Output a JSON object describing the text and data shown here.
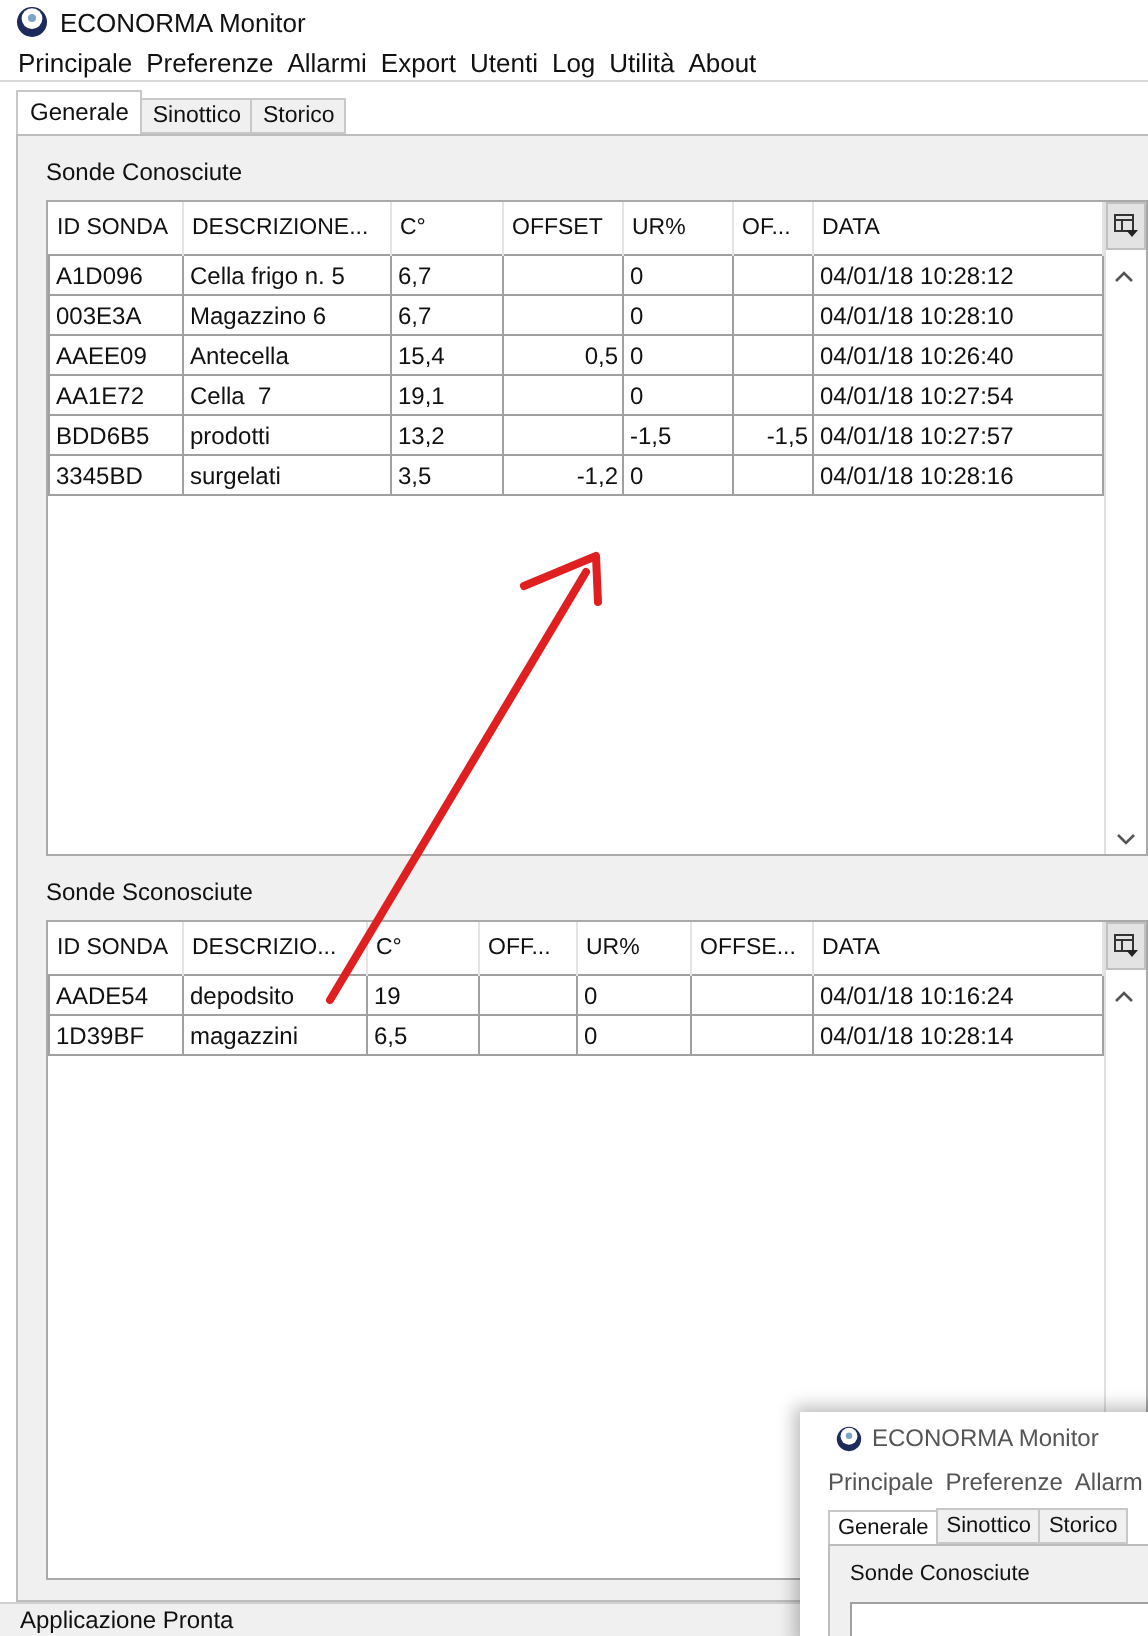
{
  "window": {
    "title": "ECONORMA Monitor"
  },
  "menu": [
    "Principale",
    "Preferenze",
    "Allarmi",
    "Export",
    "Utenti",
    "Log",
    "Utilità",
    "About"
  ],
  "tabs": [
    {
      "label": "Generale",
      "selected": true
    },
    {
      "label": "Sinottico",
      "selected": false
    },
    {
      "label": "Storico",
      "selected": false
    }
  ],
  "known_probes": {
    "title": "Sonde Conosciute",
    "columns": [
      "ID SONDA",
      "DESCRIZIONE...",
      "C°",
      "OFFSET",
      "UR%",
      "OF...",
      "DATA"
    ],
    "rows": [
      [
        "A1D096",
        "Cella frigo n. 5",
        "6,7",
        "",
        "0",
        "",
        "04/01/18 10:28:12"
      ],
      [
        "003E3A",
        "Magazzino 6",
        "6,7",
        "",
        "0",
        "",
        "04/01/18 10:28:10"
      ],
      [
        "AAEE09",
        "Antecella",
        "15,4",
        "0,5",
        "0",
        "",
        "04/01/18 10:26:40"
      ],
      [
        "AA1E72",
        "Cella  7",
        "19,1",
        "",
        "0",
        "",
        "04/01/18 10:27:54"
      ],
      [
        "BDD6B5",
        "prodotti",
        "13,2",
        "",
        "-1,5",
        "-1,5",
        "04/01/18 10:27:57"
      ],
      [
        "3345BD",
        "surgelati",
        "3,5",
        "-1,2",
        "0",
        "",
        "04/01/18 10:28:16"
      ]
    ]
  },
  "unknown_probes": {
    "title": "Sonde Sconosciute",
    "columns": [
      "ID SONDA",
      "DESCRIZIO...",
      "C°",
      "OFF...",
      "UR%",
      "OFFSE...",
      "DATA"
    ],
    "rows": [
      [
        "AADE54",
        "depodsito",
        "19",
        "",
        "0",
        "",
        "04/01/18 10:16:24"
      ],
      [
        "1D39BF",
        "magazzini",
        "6,5",
        "",
        "0",
        "",
        "04/01/18 10:28:14"
      ]
    ]
  },
  "status_bar": "Applicazione Pronta",
  "inset_window": {
    "title": "ECONORMA Monitor",
    "menu": [
      "Principale",
      "Preferenze",
      "Allarm"
    ],
    "tabs": [
      {
        "label": "Generale",
        "selected": true
      },
      {
        "label": "Sinottico",
        "selected": false
      },
      {
        "label": "Storico",
        "selected": false
      }
    ],
    "section_title": "Sonde Conosciute"
  }
}
